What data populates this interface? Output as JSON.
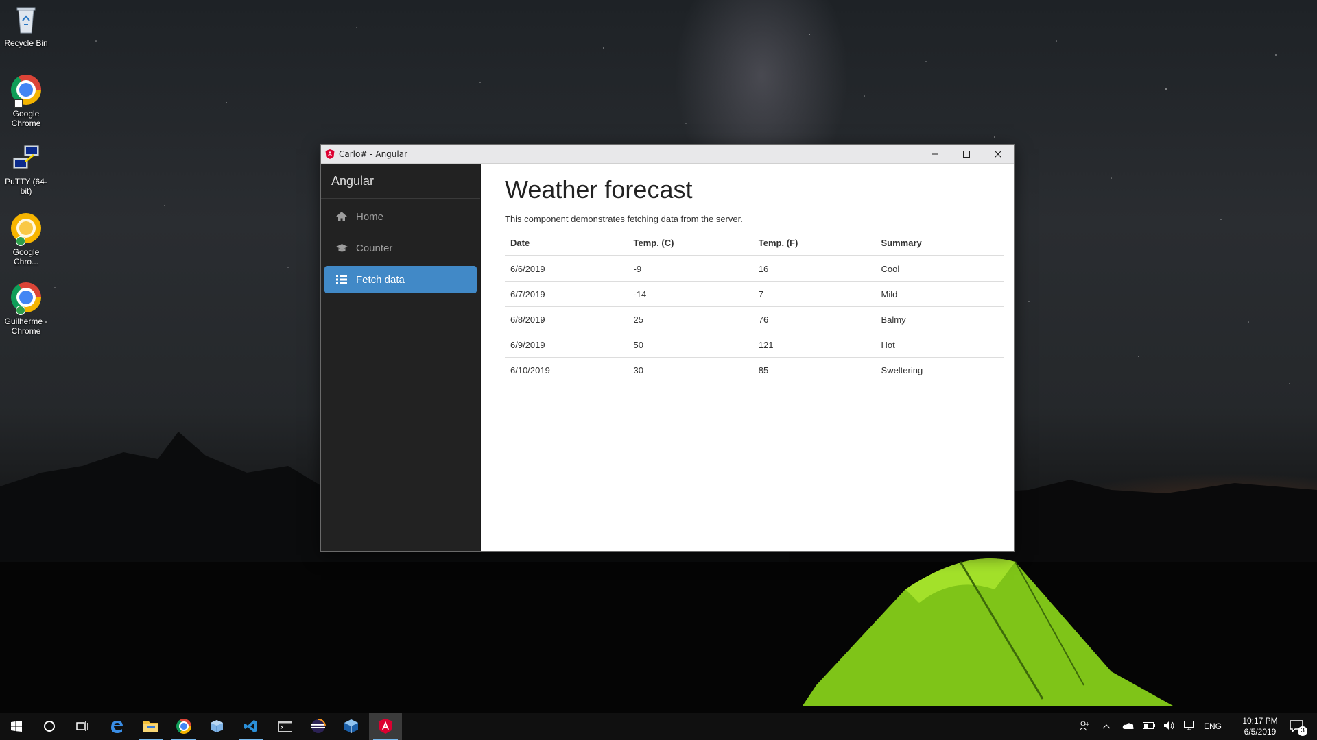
{
  "desktop": {
    "icons": [
      {
        "label": "Recycle Bin",
        "icon": "recycle-bin-icon"
      },
      {
        "label": "Google Chrome",
        "icon": "chrome-icon"
      },
      {
        "label": "PuTTY (64-bit)",
        "icon": "putty-icon"
      },
      {
        "label": "Google Chro...",
        "icon": "chrome-canary-icon"
      },
      {
        "label": "Guilherme - Chrome",
        "icon": "chrome-profile-icon"
      }
    ]
  },
  "window": {
    "title": "Carlo# - Angular",
    "controls": {
      "minimize": "minimize",
      "maximize": "maximize",
      "close": "close"
    }
  },
  "sidebar": {
    "brand": "Angular",
    "items": [
      {
        "label": "Home",
        "icon": "home-icon",
        "active": false
      },
      {
        "label": "Counter",
        "icon": "education-icon",
        "active": false
      },
      {
        "label": "Fetch data",
        "icon": "list-icon",
        "active": true
      }
    ]
  },
  "main": {
    "title": "Weather forecast",
    "description": "This component demonstrates fetching data from the server.",
    "table": {
      "headers": [
        "Date",
        "Temp. (C)",
        "Temp. (F)",
        "Summary"
      ],
      "rows": [
        [
          "6/6/2019",
          "-9",
          "16",
          "Cool"
        ],
        [
          "6/7/2019",
          "-14",
          "7",
          "Mild"
        ],
        [
          "6/8/2019",
          "25",
          "76",
          "Balmy"
        ],
        [
          "6/9/2019",
          "50",
          "121",
          "Hot"
        ],
        [
          "6/10/2019",
          "30",
          "85",
          "Sweltering"
        ]
      ]
    }
  },
  "taskbar": {
    "apps": [
      "windows-start-icon",
      "cortana-search-icon",
      "task-view-icon",
      "edge-icon",
      "file-explorer-icon",
      "chrome-icon",
      "box-app-icon",
      "vscode-icon",
      "terminal-icon",
      "eclipse-icon",
      "virtualbox-icon",
      "angular-icon"
    ],
    "tray": {
      "language": "ENG",
      "time": "10:17 PM",
      "date": "6/5/2019",
      "notifications": "3"
    }
  },
  "colors": {
    "nav_active": "#4189c7",
    "sidebar_bg": "#222222",
    "taskbar_bg": "#101010"
  }
}
